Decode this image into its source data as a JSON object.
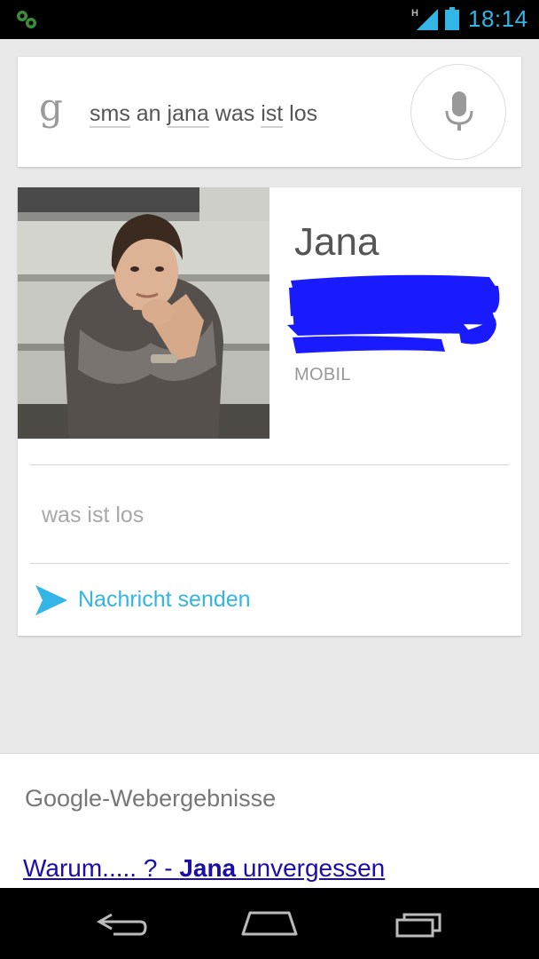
{
  "status_bar": {
    "network_type": "H",
    "time": "18:14",
    "accent_color": "#33b5e5"
  },
  "search": {
    "logo_letter": "g",
    "query_words": [
      "sms",
      "an",
      "jana",
      "was",
      "ist",
      "los"
    ],
    "mic_icon": "microphone-icon"
  },
  "contact": {
    "name": "Jana",
    "phone_number_redacted": true,
    "phone_type": "MOBIL",
    "message": "was ist los",
    "send_label": "Nachricht senden",
    "send_icon": "send-arrow-icon",
    "redaction_color": "#1a1aff"
  },
  "web_results": {
    "heading": "Google-Webergebnisse",
    "first_result": {
      "prefix": "Warum..... ? - ",
      "bold": "Jana",
      "suffix": " unvergessen"
    },
    "link_color": "#1a0dab"
  },
  "nav_bar": {
    "buttons": [
      "back-icon",
      "home-icon",
      "recent-apps-icon"
    ]
  }
}
